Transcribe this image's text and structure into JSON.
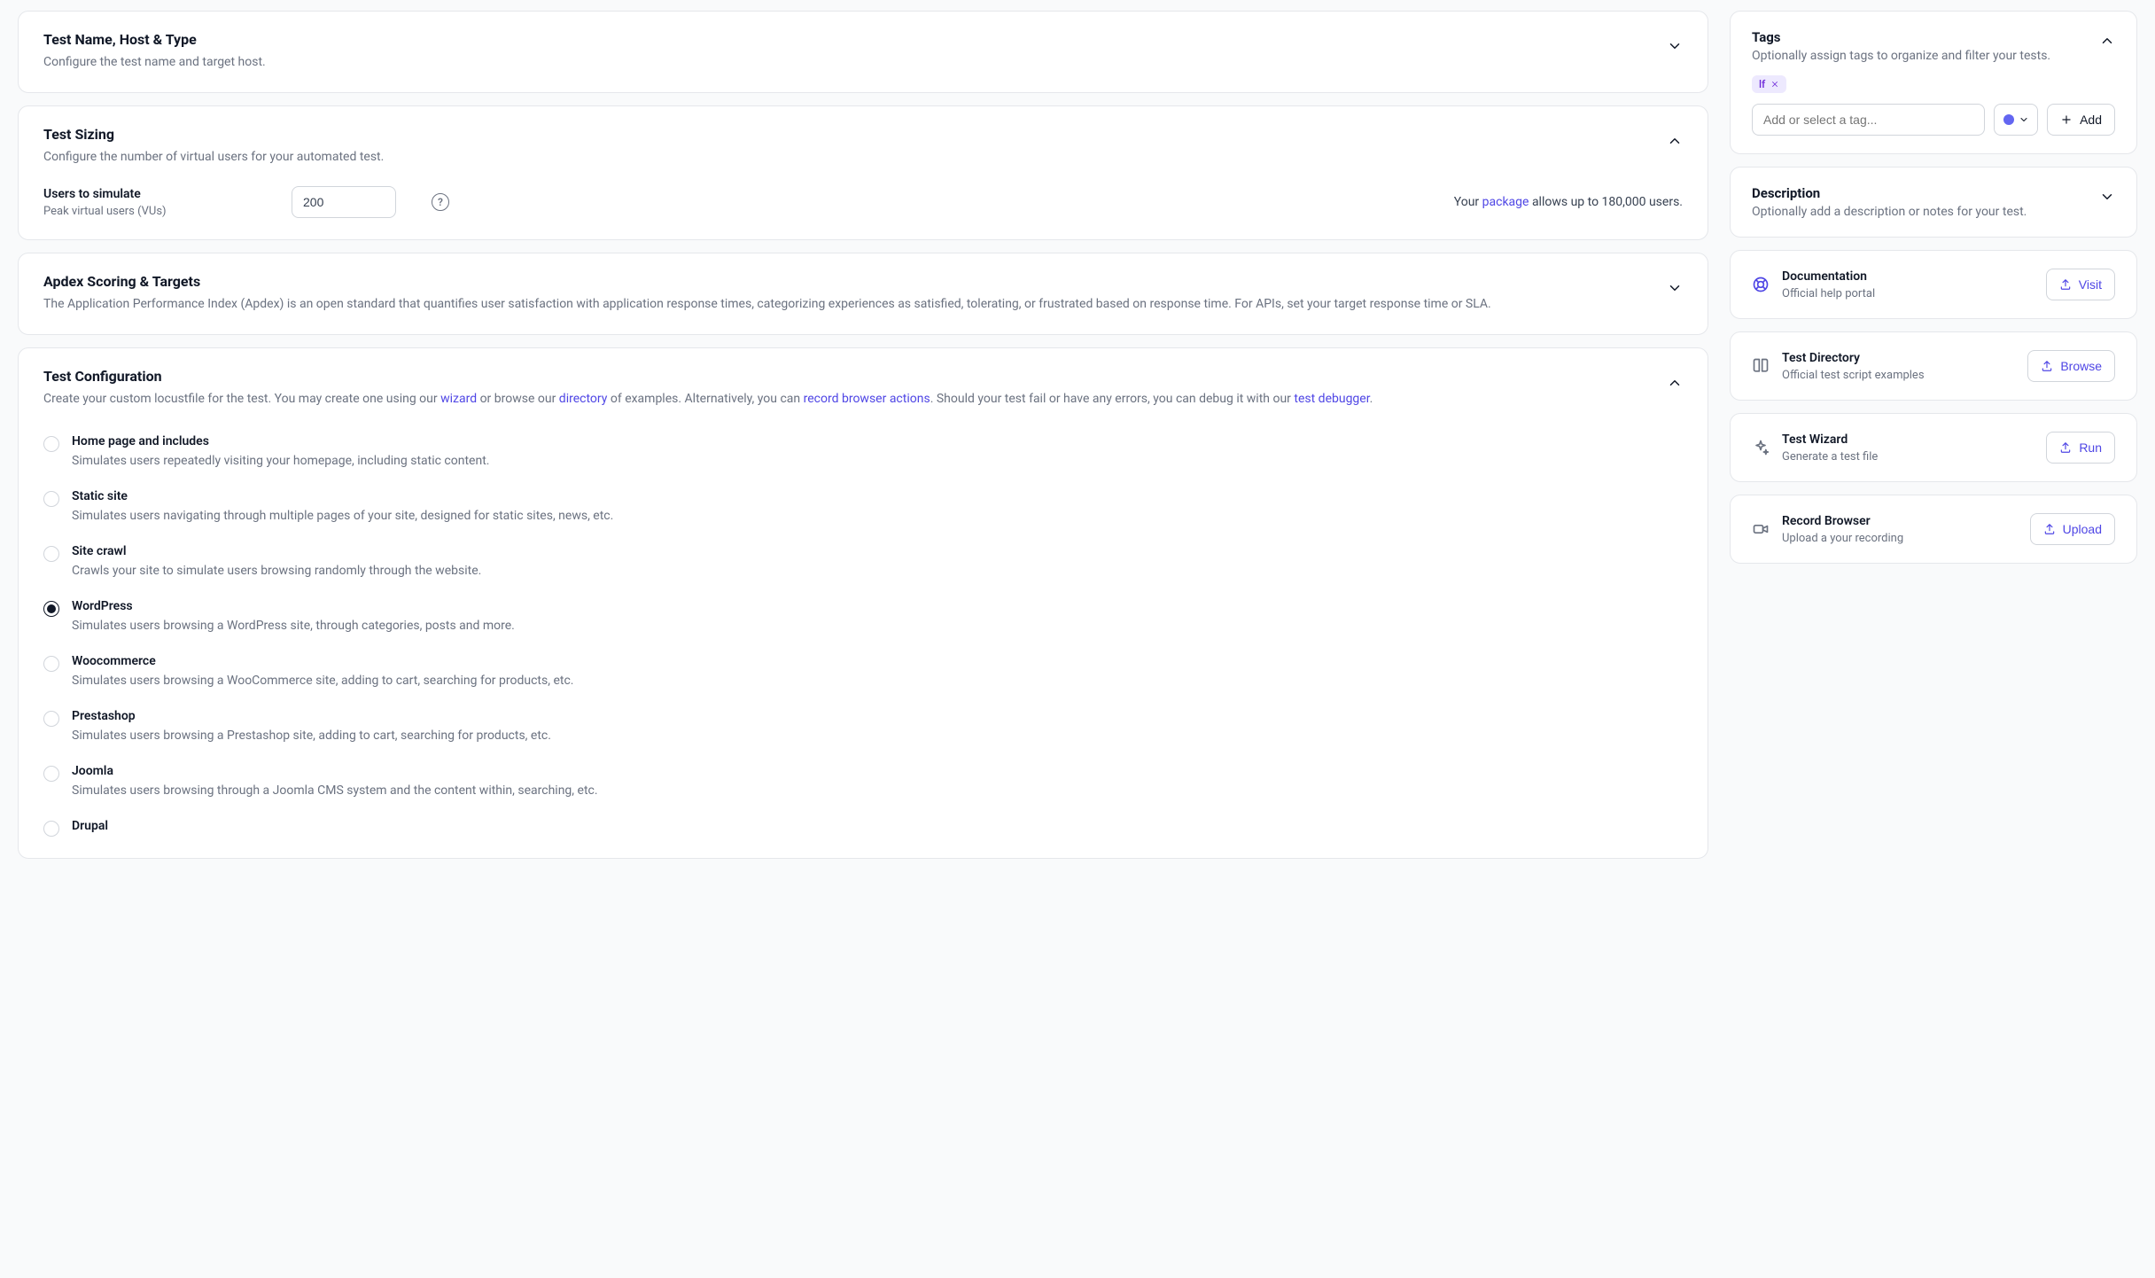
{
  "sections": {
    "nameHost": {
      "title": "Test Name, Host & Type",
      "sub": "Configure the test name and target host."
    },
    "sizing": {
      "title": "Test Sizing",
      "sub": "Configure the number of virtual users for your automated test.",
      "field_label": "Users to simulate",
      "field_sub": "Peak virtual users (VUs)",
      "value": "200",
      "pkg_pre": "Your ",
      "pkg_link": "package",
      "pkg_post": " allows up to 180,000 users."
    },
    "apdex": {
      "title": "Apdex Scoring & Targets",
      "sub": "The Application Performance Index (Apdex) is an open standard that quantifies user satisfaction with application response times, categorizing experiences as satisfied, tolerating, or frustrated based on response time. For APIs, set your target response time or SLA."
    },
    "config": {
      "title": "Test Configuration",
      "sub_a": "Create your custom locustfile for the test. You may create one using our ",
      "sub_wizard": "wizard",
      "sub_b": " or browse our ",
      "sub_directory": "directory",
      "sub_c": " of examples. Alternatively, you can ",
      "sub_record": "record browser actions",
      "sub_d": ". Should your test fail or have any errors, you can debug it with our ",
      "sub_debugger": "test debugger",
      "sub_e": ".",
      "selected": "wordpress",
      "options": [
        {
          "id": "home",
          "title": "Home page and includes",
          "desc": "Simulates users repeatedly visiting your homepage, including static content."
        },
        {
          "id": "static",
          "title": "Static site",
          "desc": "Simulates users navigating through multiple pages of your site, designed for static sites, news, etc."
        },
        {
          "id": "crawl",
          "title": "Site crawl",
          "desc": "Crawls your site to simulate users browsing randomly through the website."
        },
        {
          "id": "wordpress",
          "title": "WordPress",
          "desc": "Simulates users browsing a WordPress site, through categories, posts and more."
        },
        {
          "id": "woo",
          "title": "Woocommerce",
          "desc": "Simulates users browsing a WooCommerce site, adding to cart, searching for products, etc."
        },
        {
          "id": "prestashop",
          "title": "Prestashop",
          "desc": "Simulates users browsing a Prestashop site, adding to cart, searching for products, etc."
        },
        {
          "id": "joomla",
          "title": "Joomla",
          "desc": "Simulates users browsing through a Joomla CMS system and the content within, searching, etc."
        },
        {
          "id": "drupal",
          "title": "Drupal",
          "desc": ""
        }
      ]
    }
  },
  "right": {
    "tags": {
      "title": "Tags",
      "sub": "Optionally assign tags to organize and filter your tests.",
      "chip": "lf",
      "placeholder": "Add or select a tag...",
      "add": "Add",
      "color": "#6366f1"
    },
    "description": {
      "title": "Description",
      "sub": "Optionally add a description or notes for your test."
    },
    "links": [
      {
        "id": "docs",
        "icon": "lifebuoy",
        "title": "Documentation",
        "sub": "Official help portal",
        "btn": "Visit",
        "iconColor": "indigo"
      },
      {
        "id": "directory",
        "icon": "book",
        "title": "Test Directory",
        "sub": "Official test script examples",
        "btn": "Browse",
        "iconColor": "gray"
      },
      {
        "id": "wizard",
        "icon": "sparkle",
        "title": "Test Wizard",
        "sub": "Generate a test file",
        "btn": "Run",
        "iconColor": "gray"
      },
      {
        "id": "record",
        "icon": "video",
        "title": "Record Browser",
        "sub": "Upload a your recording",
        "btn": "Upload",
        "iconColor": "gray"
      }
    ]
  }
}
